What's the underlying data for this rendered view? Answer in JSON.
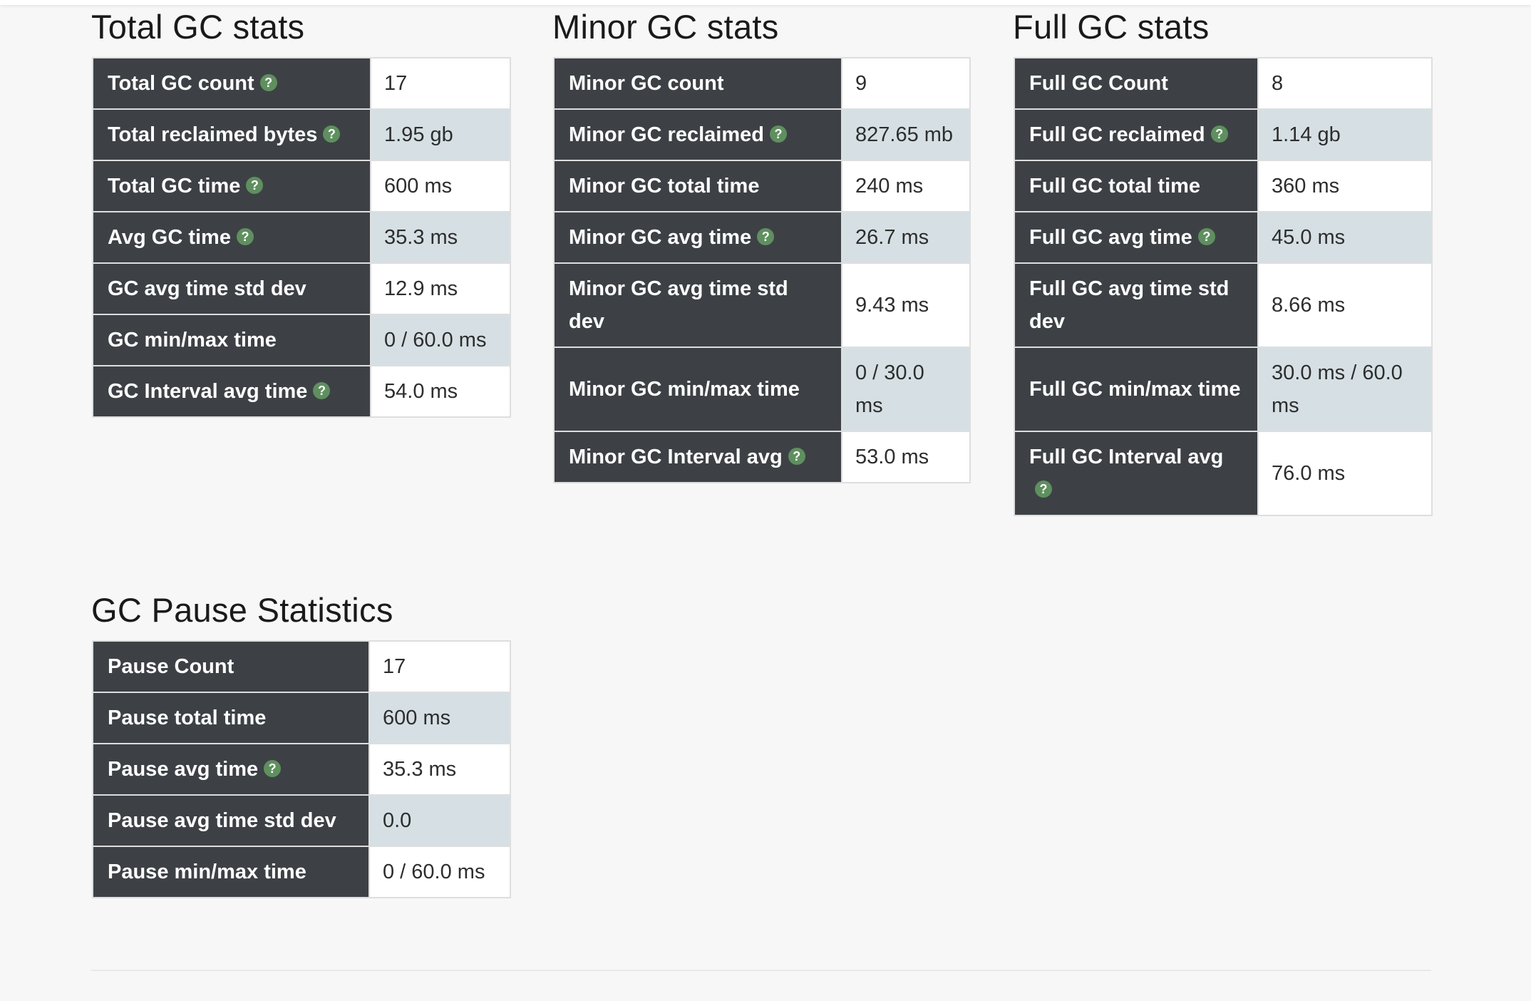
{
  "panels": [
    {
      "title": "Total GC stats",
      "rows": [
        {
          "label": "Total GC count",
          "value": "17",
          "help": true
        },
        {
          "label": "Total reclaimed bytes",
          "value": "1.95 gb",
          "help": true
        },
        {
          "label": "Total GC time",
          "value": "600 ms",
          "help": true
        },
        {
          "label": "Avg GC time",
          "value": "35.3 ms",
          "help": true
        },
        {
          "label": "GC avg time std dev",
          "value": "12.9 ms",
          "help": false
        },
        {
          "label": "GC min/max time",
          "value": "0 / 60.0 ms",
          "help": false
        },
        {
          "label": "GC Interval avg time",
          "value": "54.0 ms",
          "help": true
        }
      ]
    },
    {
      "title": "Minor GC stats",
      "rows": [
        {
          "label": "Minor GC count",
          "value": "9",
          "help": false
        },
        {
          "label": "Minor GC reclaimed",
          "value": "827.65 mb",
          "help": true
        },
        {
          "label": "Minor GC total time",
          "value": "240 ms",
          "help": false
        },
        {
          "label": "Minor GC avg time",
          "value": "26.7 ms",
          "help": true
        },
        {
          "label": "Minor GC avg time std dev",
          "value": "9.43 ms",
          "help": false
        },
        {
          "label": "Minor GC min/max time",
          "value": "0 / 30.0 ms",
          "help": false
        },
        {
          "label": "Minor GC Interval avg",
          "value": "53.0 ms",
          "help": true
        }
      ]
    },
    {
      "title": "Full GC stats",
      "rows": [
        {
          "label": "Full GC Count",
          "value": "8",
          "help": false
        },
        {
          "label": "Full GC reclaimed",
          "value": "1.14 gb",
          "help": true
        },
        {
          "label": "Full GC total time",
          "value": "360 ms",
          "help": false
        },
        {
          "label": "Full GC avg time",
          "value": "45.0 ms",
          "help": true
        },
        {
          "label": "Full GC avg time std dev",
          "value": "8.66 ms",
          "help": false
        },
        {
          "label": "Full GC min/max time",
          "value": "30.0 ms / 60.0 ms",
          "help": false
        },
        {
          "label": "Full GC Interval avg",
          "value": "76.0 ms",
          "help": true
        }
      ]
    },
    {
      "title": "GC Pause Statistics",
      "rows": [
        {
          "label": "Pause Count",
          "value": "17",
          "help": false
        },
        {
          "label": "Pause total time",
          "value": "600 ms",
          "help": false
        },
        {
          "label": "Pause avg time",
          "value": "35.3 ms",
          "help": true
        },
        {
          "label": "Pause avg time std dev",
          "value": "0.0",
          "help": false
        },
        {
          "label": "Pause min/max time",
          "value": "0 / 60.0 ms",
          "help": false
        }
      ]
    }
  ],
  "help_glyph": "?",
  "icons": {
    "help": "question-circle-icon"
  },
  "colors": {
    "label_bg": "#3d4145",
    "value_bg": "#ffffff",
    "value_alt_bg": "#d6e0e4",
    "help_icon": "#5f8f5f",
    "page_bg": "#f7f7f7"
  }
}
